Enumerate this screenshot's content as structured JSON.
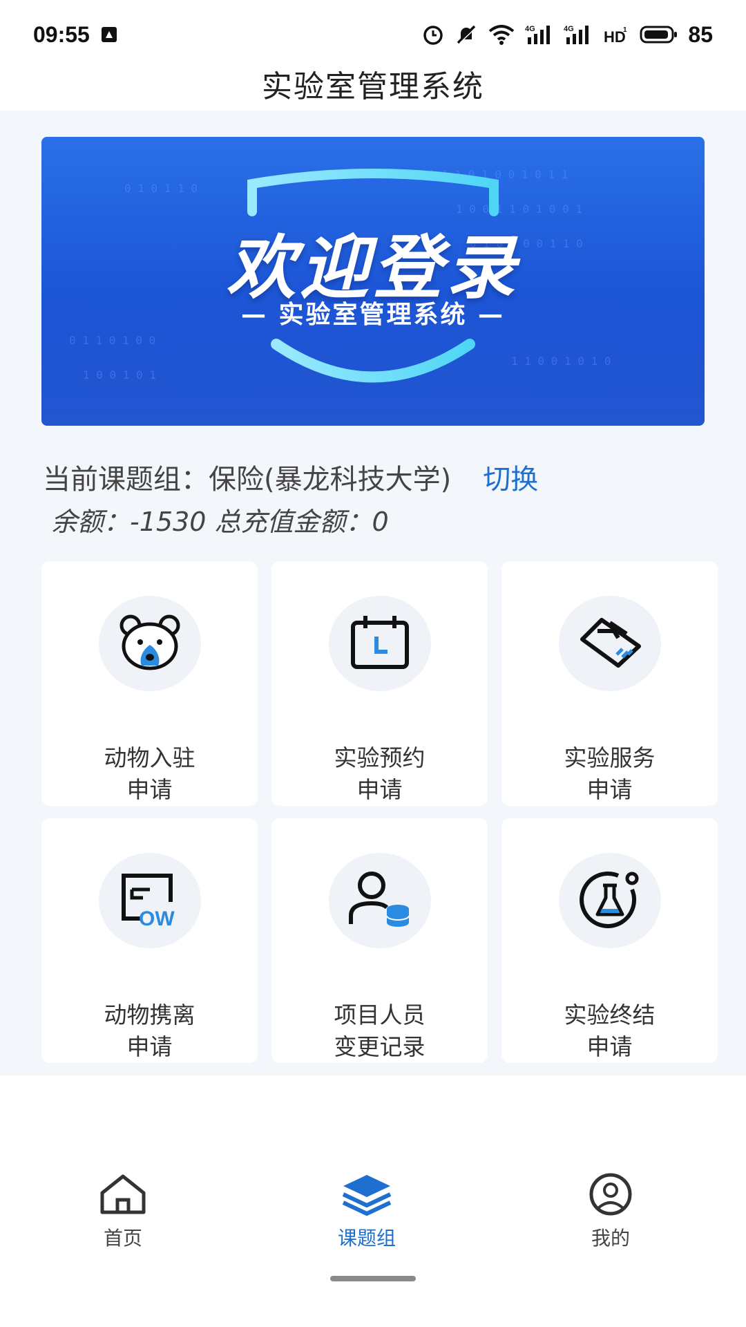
{
  "status_bar": {
    "time": "09:55",
    "battery": "85",
    "icons": [
      "notification-box-icon",
      "alarm-icon",
      "mute-icon",
      "wifi-icon",
      "signal-4g-icon",
      "signal-4g-icon",
      "hd-icon",
      "battery-icon"
    ]
  },
  "header": {
    "title": "实验室管理系统"
  },
  "banner": {
    "heading": "欢迎登录",
    "subtitle": "— 实验室管理系统 —"
  },
  "group": {
    "current_label": "当前课题组：保险(暴龙科技大学)",
    "switch_label": "切换",
    "balance_text": "余额：-1530 总充值金额：0"
  },
  "grid": {
    "cards": [
      {
        "line1": "动物入驻",
        "line2": "申请",
        "icon": "bear-icon"
      },
      {
        "line1": "实验预约",
        "line2": "申请",
        "icon": "calendar-icon"
      },
      {
        "line1": "实验服务",
        "line2": "申请",
        "icon": "handshake-icon"
      },
      {
        "line1": "动物携离",
        "line2": "申请",
        "icon": "flow-icon"
      },
      {
        "line1": "项目人员",
        "line2": "变更记录",
        "icon": "user-database-icon"
      },
      {
        "line1": "实验终结",
        "line2": "申请",
        "icon": "flask-icon"
      }
    ]
  },
  "nav": {
    "items": [
      {
        "label": "首页",
        "icon": "home-icon"
      },
      {
        "label": "课题组",
        "icon": "layers-icon"
      },
      {
        "label": "我的",
        "icon": "user-icon"
      }
    ],
    "active_index": 1
  },
  "colors": {
    "accent": "#1f6fd0",
    "banner_top": "#2a70e8",
    "banner_bottom": "#1c55d6",
    "page_bg": "#f3f6fa",
    "icon_circle_bg": "#eff2f7"
  }
}
